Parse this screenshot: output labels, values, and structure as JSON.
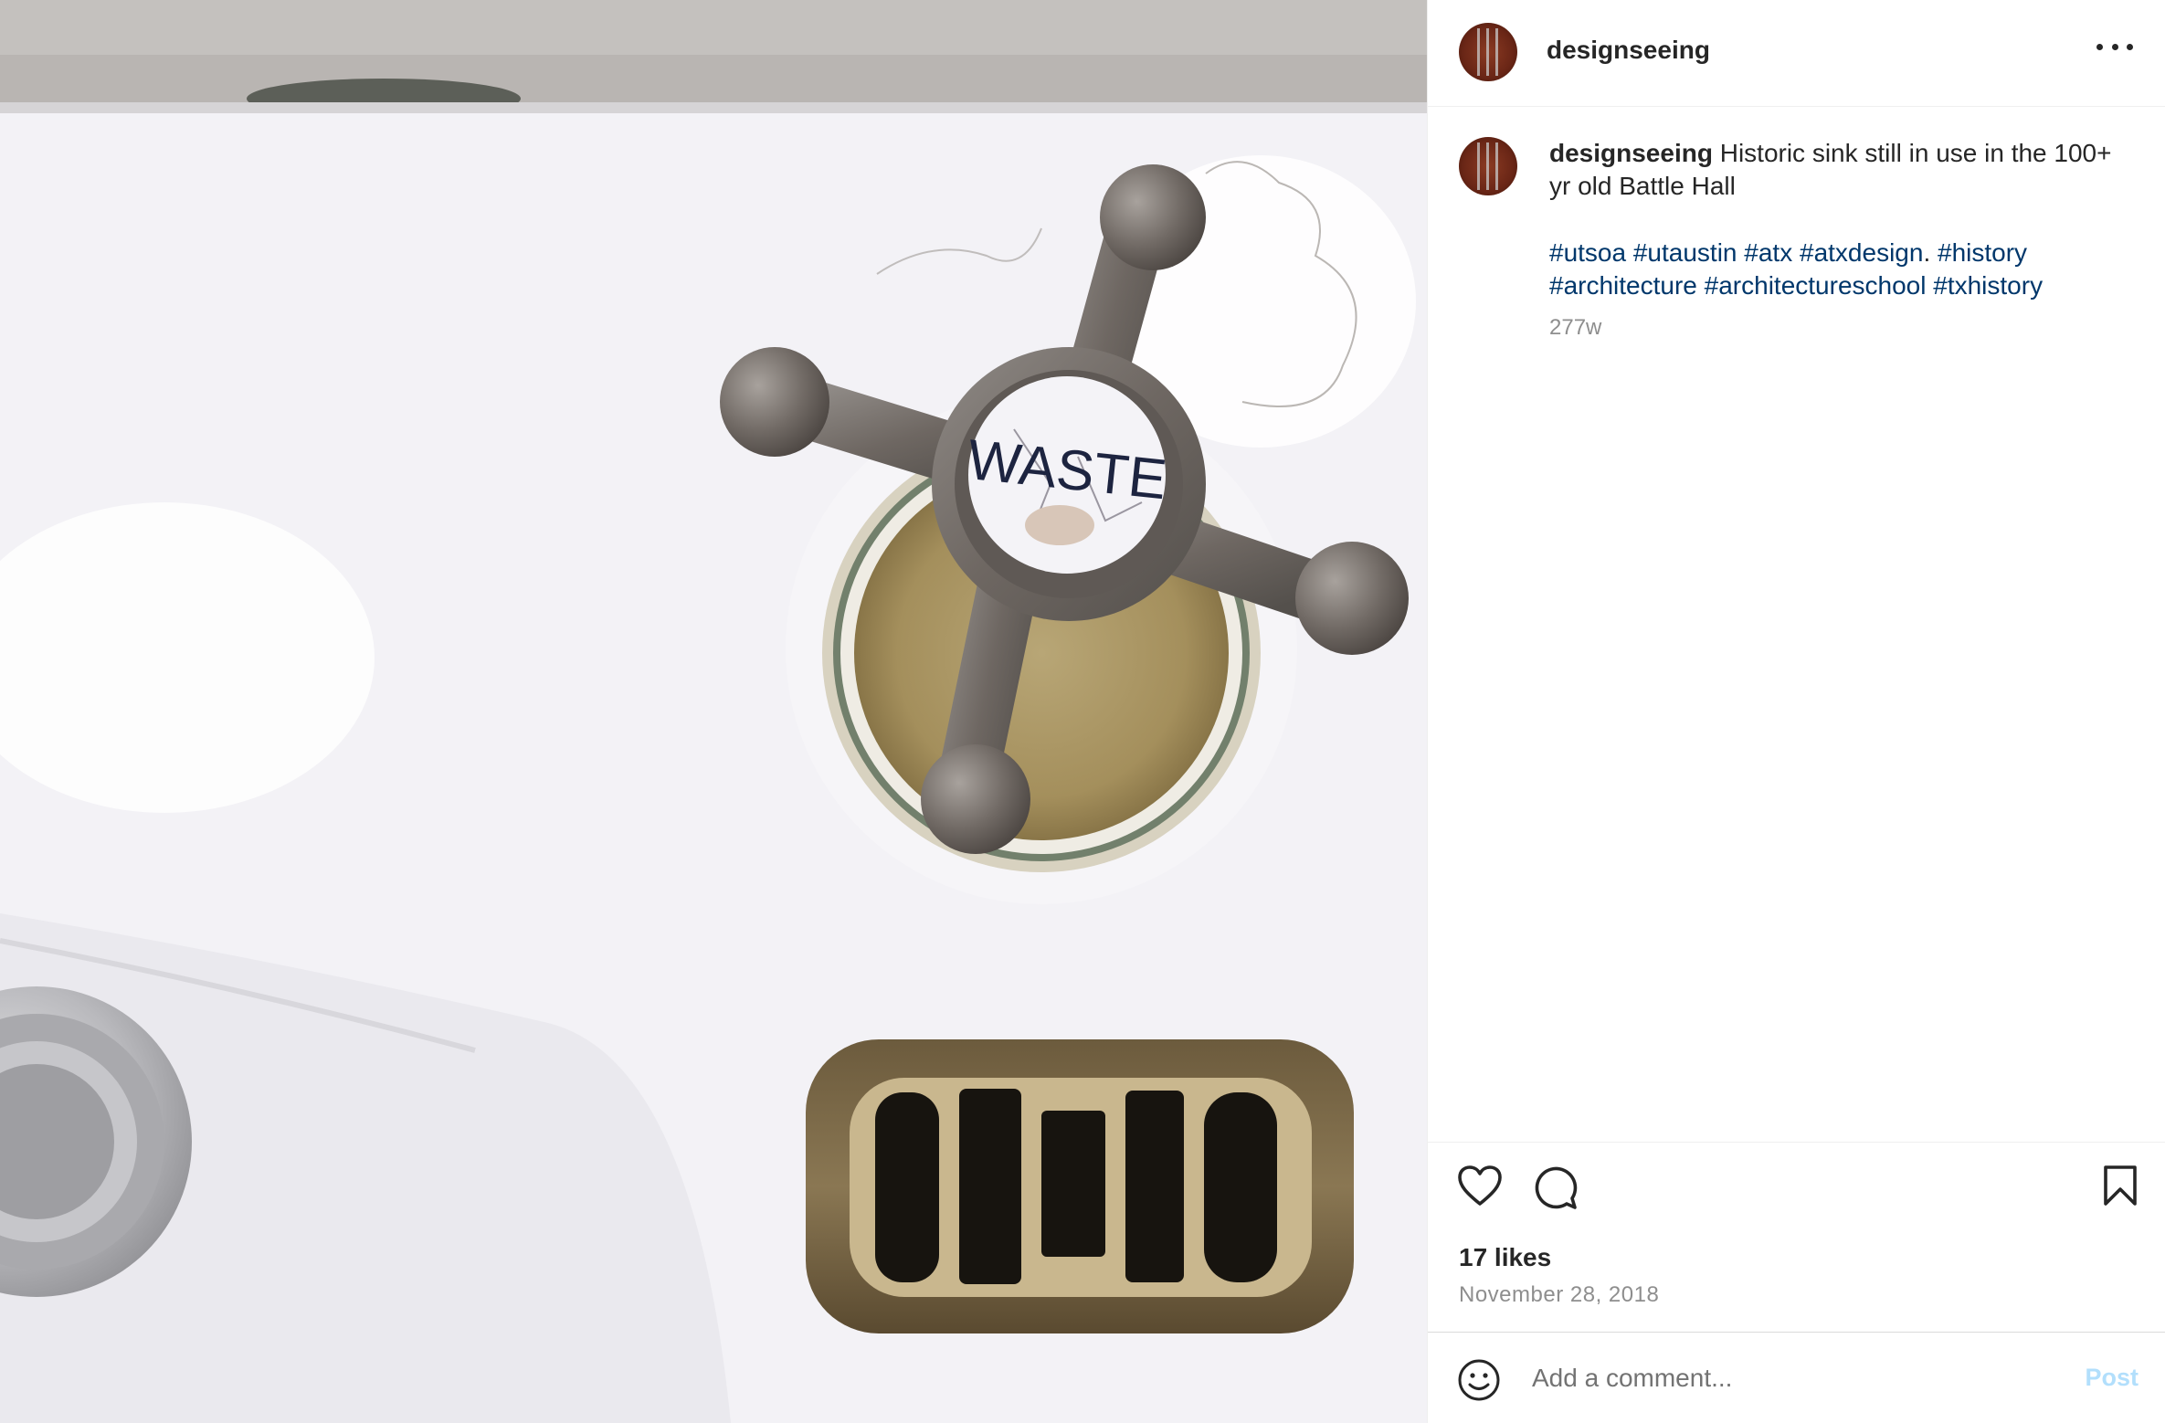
{
  "post": {
    "username": "designseeing",
    "more_icon": "more-horizontal-icon",
    "caption": {
      "username": "designseeing",
      "text": " Historic sink still in use in the 100+ yr old Battle Hall"
    },
    "hashtags": [
      "#utsoa",
      "#utaustin",
      "#atx",
      "#atxdesign",
      "#history",
      "#architecture",
      "#architectureschool",
      "#txhistory"
    ],
    "hashtag_separator_after_atxdesign": ".",
    "age": "277w",
    "likes": "17 likes",
    "date": "November 28, 2018",
    "comment_placeholder": "Add a comment...",
    "post_label": "Post"
  },
  "photo": {
    "label_text": "WASTE"
  },
  "colors": {
    "link": "#00376b",
    "text": "#262626",
    "secondary": "#8e8e8e",
    "post_disabled": "#b2dffc"
  },
  "icons": [
    "heart-icon",
    "comment-icon",
    "bookmark-icon",
    "emoji-icon"
  ]
}
